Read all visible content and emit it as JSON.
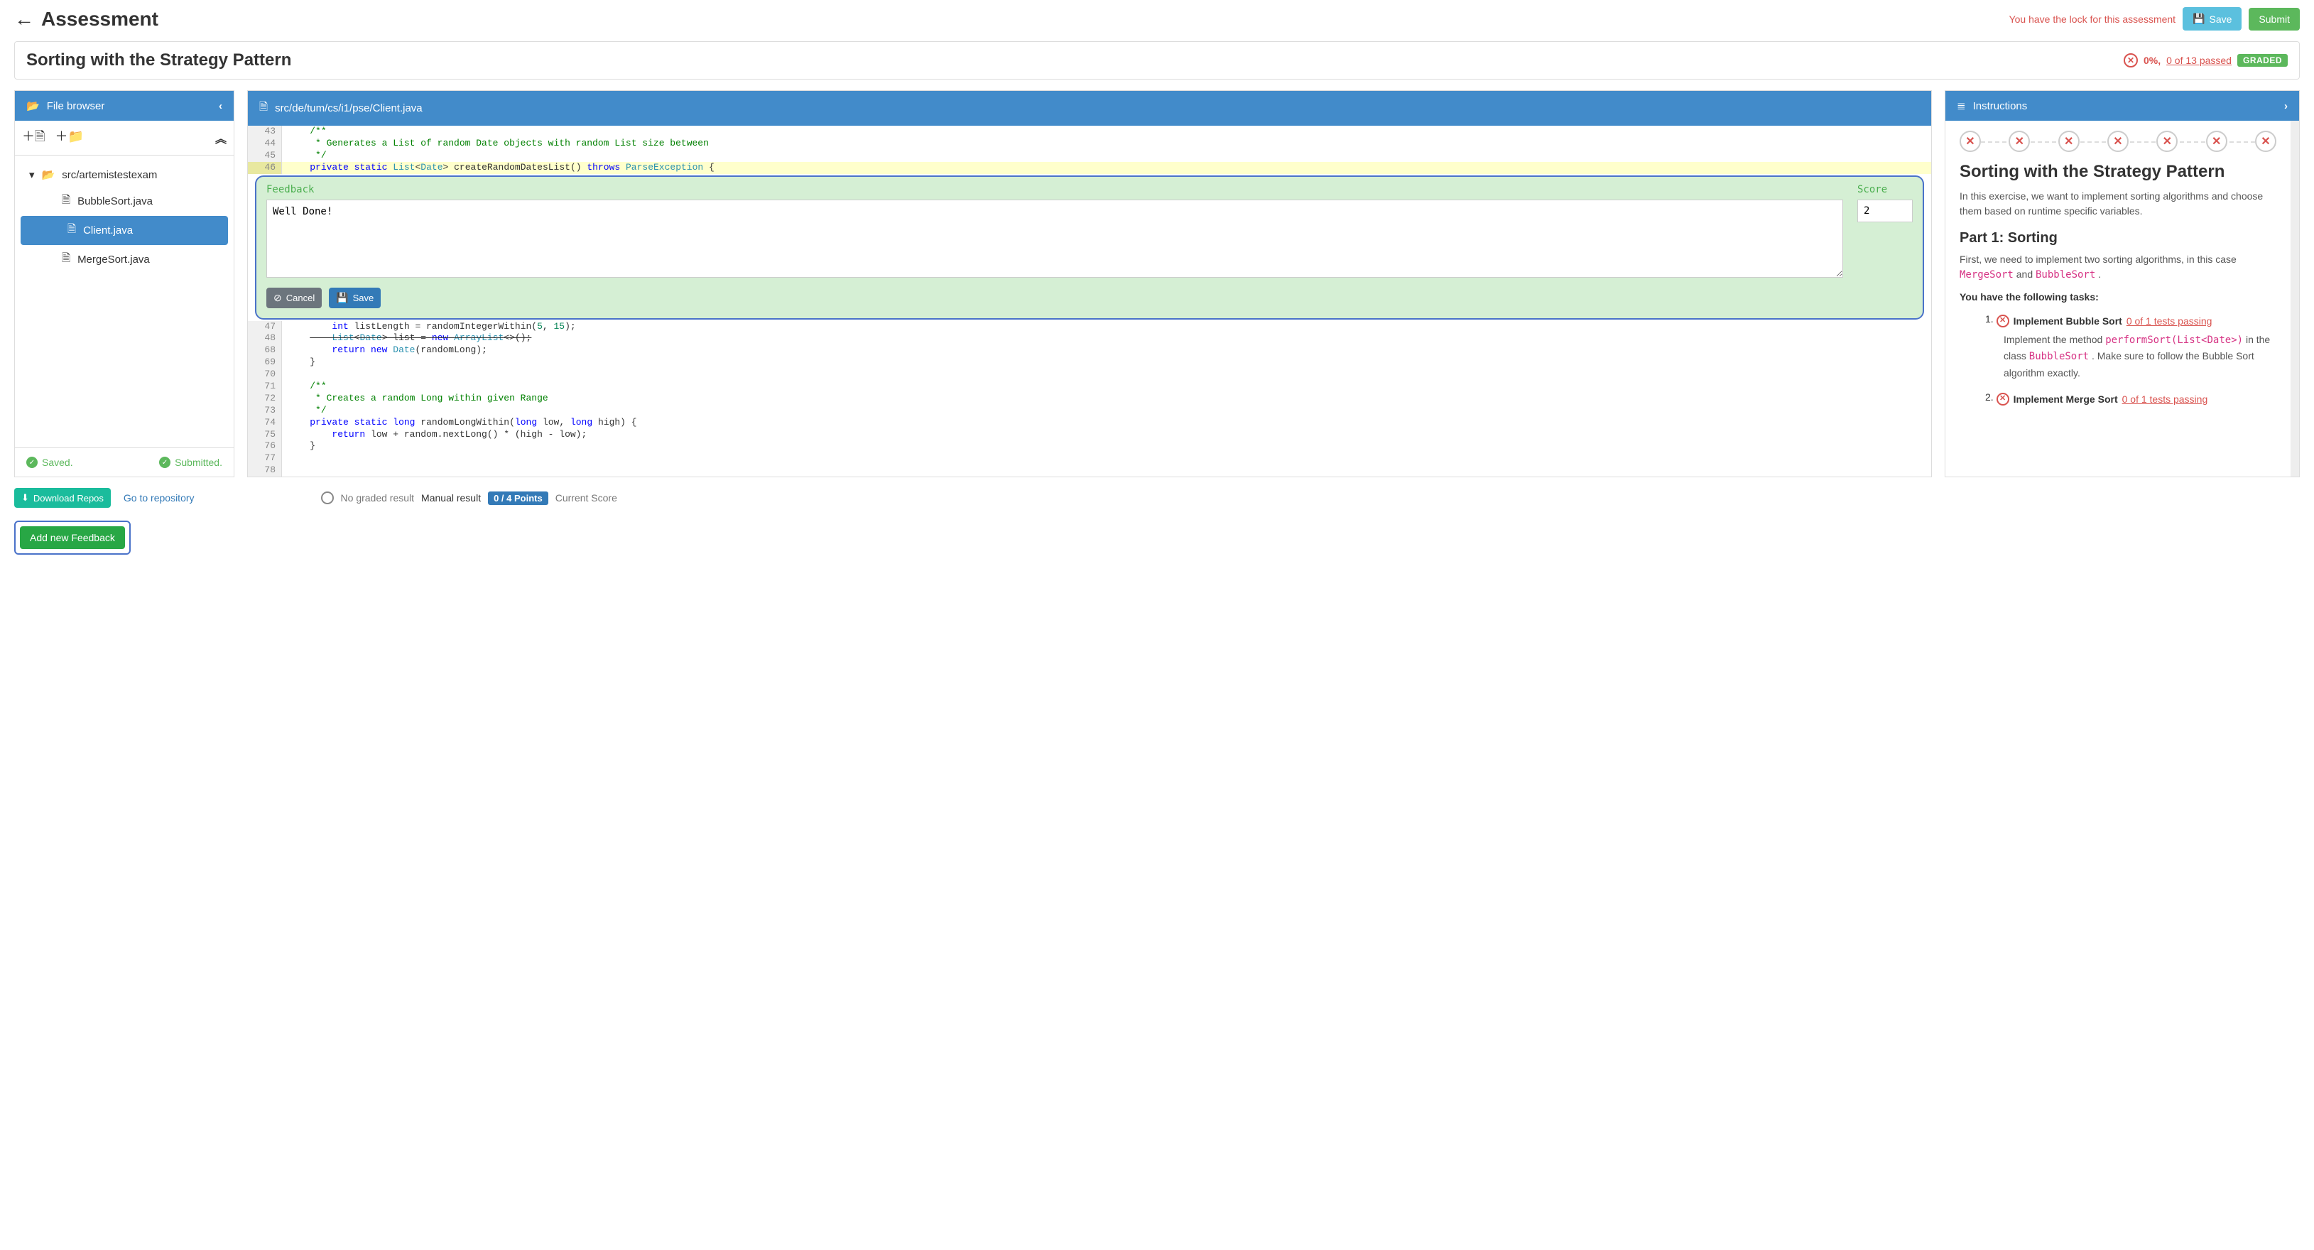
{
  "header": {
    "back": "←",
    "title": "Assessment",
    "lock_text": "You have the lock for this assessment",
    "save_label": "Save",
    "submit_label": "Submit"
  },
  "exercise": {
    "title": "Sorting with the Strategy Pattern",
    "percent": "0%,",
    "passed": "0 of 13 passed",
    "graded": "GRADED"
  },
  "file_browser": {
    "title": "File browser",
    "root": "src/artemistestexam",
    "files": [
      "BubbleSort.java",
      "Client.java",
      "MergeSort.java"
    ],
    "saved": "Saved.",
    "submitted": "Submitted."
  },
  "code": {
    "path": "src/de/tum/cs/i1/pse/Client.java",
    "lines_before": [
      {
        "n": 43,
        "txt": "/**",
        "cls": "kw-comment"
      },
      {
        "n": 44,
        "txt": " * Generates a List of random Date objects with random List size between",
        "cls": "kw-comment"
      },
      {
        "n": 45,
        "txt": " */",
        "cls": "kw-comment"
      },
      {
        "n": 46,
        "txt": "private static List<Date> createRandomDatesList() throws ParseException {",
        "cls": "",
        "hl": true
      }
    ],
    "lines_after": [
      {
        "n": 47,
        "txt": "    int listLength = randomIntegerWithin(5, 15);"
      },
      {
        "n": 48,
        "txt": "    List<Date> list = new ArrayList<>();",
        "strike": true
      },
      {
        "n": 68,
        "txt": "    return new Date(randomLong);"
      },
      {
        "n": 69,
        "txt": "}"
      },
      {
        "n": 70,
        "txt": ""
      },
      {
        "n": 71,
        "txt": "/**",
        "cls": "kw-comment"
      },
      {
        "n": 72,
        "txt": " * Creates a random Long within given Range",
        "cls": "kw-comment"
      },
      {
        "n": 73,
        "txt": " */",
        "cls": "kw-comment"
      },
      {
        "n": 74,
        "txt": "private static long randomLongWithin(long low, long high) {"
      },
      {
        "n": 75,
        "txt": "    return low + random.nextLong() * (high - low);"
      },
      {
        "n": 76,
        "txt": "}"
      },
      {
        "n": 77,
        "txt": ""
      },
      {
        "n": 78,
        "txt": ""
      }
    ]
  },
  "feedback": {
    "header_feedback": "Feedback",
    "header_score": "Score",
    "text": "Well Done!",
    "score": "2",
    "cancel": "Cancel",
    "save": "Save"
  },
  "instructions": {
    "title": "Instructions",
    "h1": "Sorting with the Strategy Pattern",
    "intro": "In this exercise, we want to implement sorting algorithms and choose them based on runtime specific variables.",
    "part1": "Part 1: Sorting",
    "part1_p1_a": "First, we need to implement two sorting algorithms, in this case ",
    "part1_merge": "MergeSort",
    "part1_and": " and ",
    "part1_bubble": "BubbleSort",
    "part1_p1_b": ".",
    "tasks_intro": "You have the following tasks:",
    "tasks": [
      {
        "n": "1.",
        "title": "Implement Bubble Sort",
        "status": "0 of 1 tests passing",
        "body_a": "Implement the method ",
        "body_code": "performSort(List<Date>)",
        "body_b": " in the class ",
        "body_cls": "BubbleSort",
        "body_c": ". Make sure to follow the Bubble Sort algorithm exactly."
      },
      {
        "n": "2.",
        "title": "Implement Merge Sort",
        "status": "0 of 1 tests passing"
      }
    ]
  },
  "footer": {
    "download": "Download Repos",
    "goto": "Go to repository",
    "no_result": "No graded result",
    "manual": "Manual result",
    "points": "0 / 4 Points",
    "current": "Current Score",
    "add_feedback": "Add new Feedback"
  }
}
